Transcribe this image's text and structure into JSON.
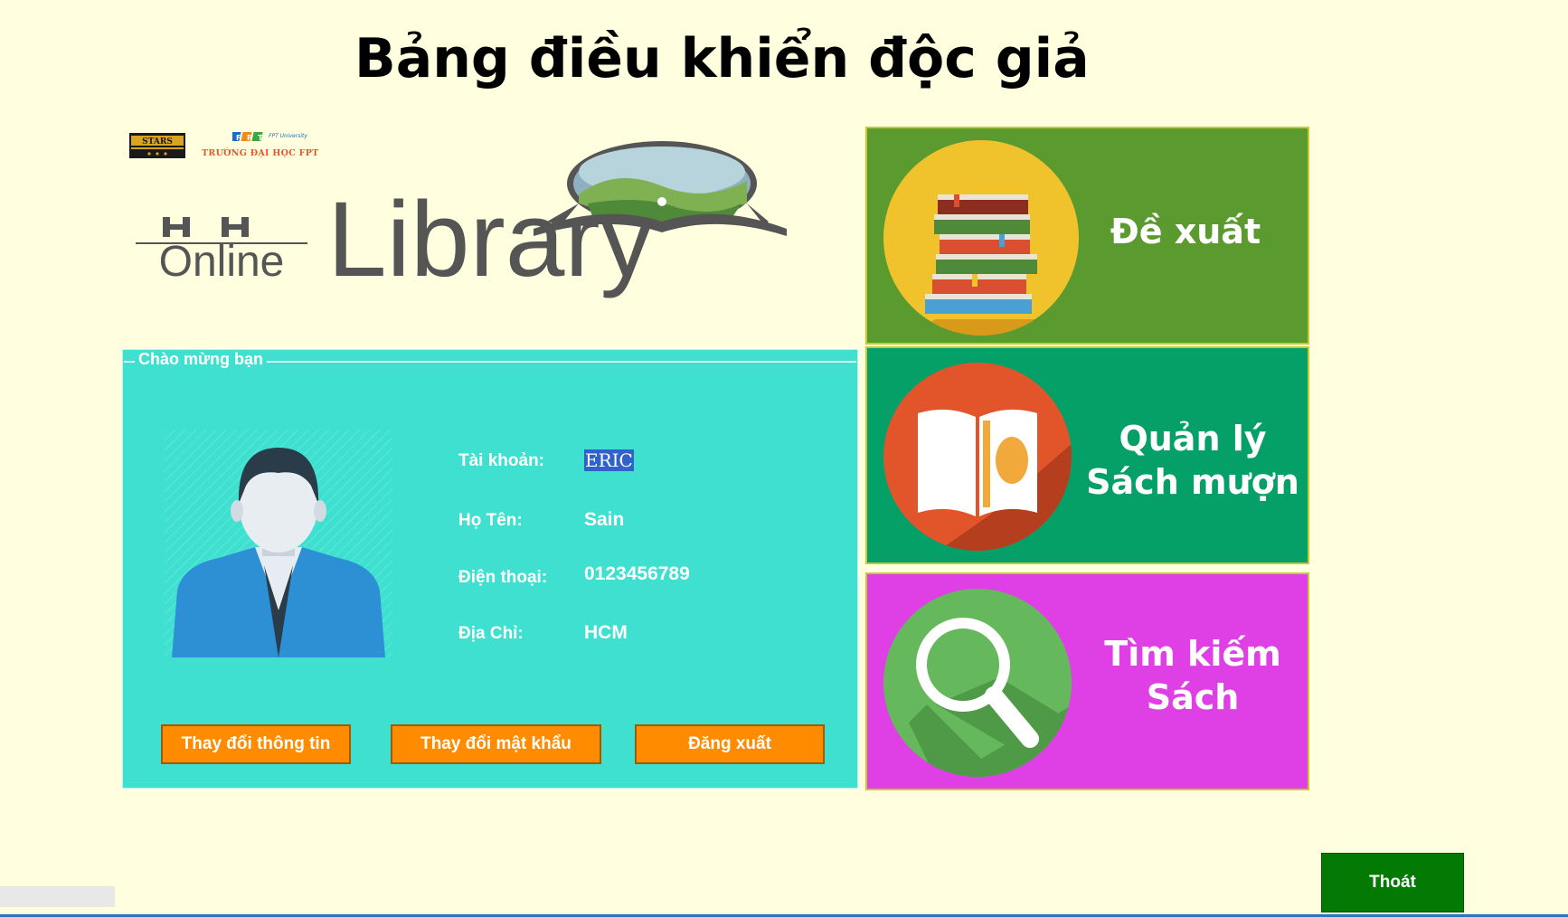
{
  "window": {
    "title": "Bảng điều khiển độc giả"
  },
  "logos": {
    "stars": "STARS",
    "fpt_small": "FPT University",
    "fpt_text": "TRƯỜNG ĐẠI HỌC FPT",
    "hh": "H H",
    "online": "Online",
    "library": "Library"
  },
  "welcome": {
    "legend": "Chào mừng bạn",
    "fields": [
      {
        "label": "Tài khoản:",
        "value": "ERIC"
      },
      {
        "label": "Họ Tên:",
        "value": "Sain"
      },
      {
        "label": "Điện thoại:",
        "value": "0123456789"
      },
      {
        "label": "Địa Chỉ:",
        "value": "HCM"
      }
    ],
    "buttons": {
      "change_info": "Thay đổi thông tin",
      "change_password": "Thay đổi mật khẩu",
      "logout": "Đăng xuất"
    }
  },
  "tiles": [
    {
      "label_line1": "Đề xuất",
      "label_line2": "",
      "color": "#5b9a2e",
      "icon": "books-stack-icon"
    },
    {
      "label_line1": "Quản lý",
      "label_line2": "Sách mượn",
      "color": "#05a068",
      "icon": "open-book-icon"
    },
    {
      "label_line1": "Tìm kiếm",
      "label_line2": "Sách",
      "color": "#de40e6",
      "icon": "magnifier-icon"
    }
  ],
  "exit_button": "Thoát",
  "colors": {
    "background": "#ffffe0",
    "panel": "#40e0d0",
    "orange_button": "#ff8c00",
    "exit_button": "#037a03"
  }
}
